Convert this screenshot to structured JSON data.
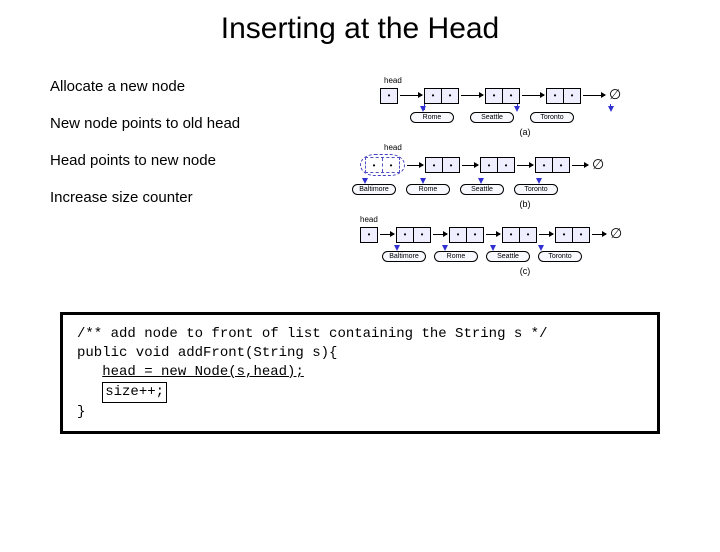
{
  "title": "Inserting at the Head",
  "steps": {
    "s1": "Allocate a new node",
    "s2": "New node points to old head",
    "s3": "Head points to new node",
    "s4": "Increase size counter"
  },
  "diagrams": {
    "head_label": "head",
    "null_symbol": "∅",
    "dot": "•",
    "caption_a": "(a)",
    "caption_b": "(b)",
    "caption_c": "(c)",
    "cities": {
      "rome": "Rome",
      "seattle": "Seattle",
      "toronto": "Toronto",
      "baltimore": "Baltimore"
    }
  },
  "code": {
    "line1": "/** add node to front of list containing the String s */",
    "line2": "public void addFront(String s){",
    "line3": "head = new Node(s,head);",
    "line4": "size++;",
    "line5": "}"
  }
}
